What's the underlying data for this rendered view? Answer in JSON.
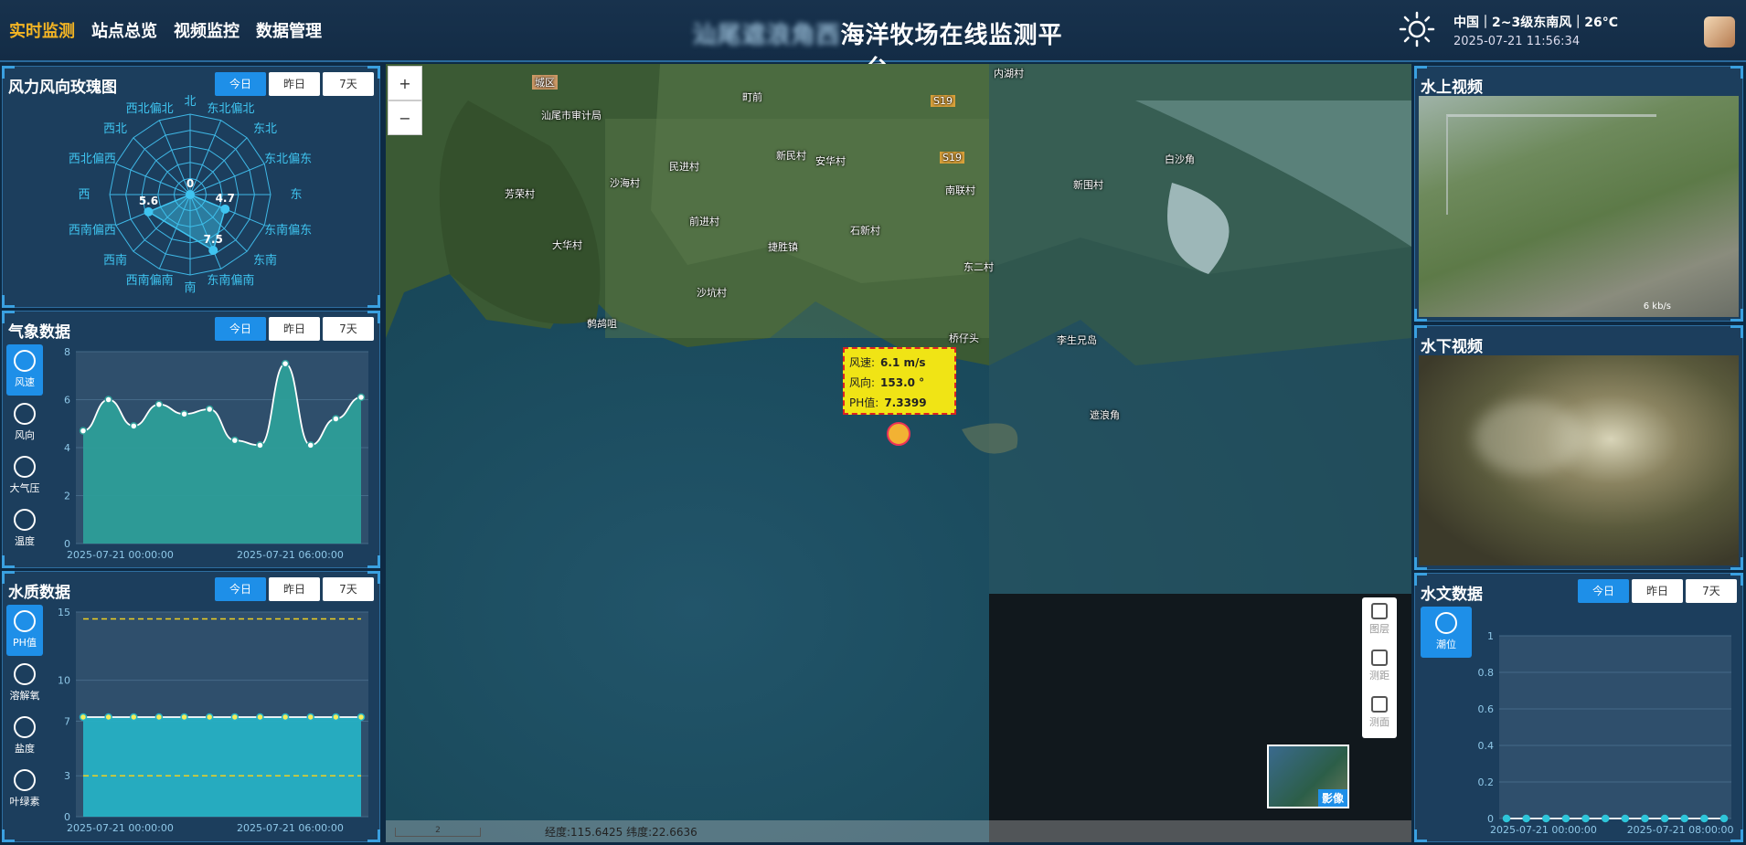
{
  "nav": [
    "实时监测",
    "站点总览",
    "视频监控",
    "数据管理"
  ],
  "title_blur": "汕尾遮浪角西",
  "title": "海洋牧场在线监测平台",
  "weather": {
    "line1": "中国｜2~3级东南风｜26°C",
    "datetime": "2025-07-21 11:56:34",
    "icon": "sun-icon"
  },
  "tabs": [
    "今日",
    "昨日",
    "7天"
  ],
  "rose": {
    "title": "风力风向玫瑰图",
    "directions": [
      "北",
      "东北偏北",
      "东北",
      "东北偏东",
      "东",
      "东南偏东",
      "东南",
      "东南偏南",
      "南",
      "西南偏南",
      "西南",
      "西南偏西",
      "西",
      "西北偏西",
      "西北",
      "西北偏北"
    ],
    "values": [
      {
        "dir": "北",
        "value": 0
      },
      {
        "dir": "东南偏东",
        "value": 4.7
      },
      {
        "dir": "东南偏南",
        "value": 7.5
      },
      {
        "dir": "西南偏西",
        "value": 5.6
      }
    ],
    "max": 10
  },
  "weather_panel": {
    "title": "气象数据",
    "buttons": [
      {
        "label": "风速",
        "icon": "fan-icon"
      },
      {
        "label": "风向",
        "icon": "wind-direction-icon"
      },
      {
        "label": "大气压",
        "icon": "pressure-icon"
      },
      {
        "label": "温度",
        "icon": "thermometer-icon"
      }
    ]
  },
  "water_panel": {
    "title": "水质数据",
    "buttons": [
      {
        "label": "PH值",
        "icon": "ph-icon"
      },
      {
        "label": "溶解氧",
        "icon": "oxygen-icon"
      },
      {
        "label": "盐度",
        "icon": "salinity-icon"
      },
      {
        "label": "叶绿素",
        "icon": "chlorophyll-icon"
      }
    ]
  },
  "hydro_panel": {
    "title": "水文数据",
    "buttons": [
      {
        "label": "潮位",
        "icon": "tide-icon"
      }
    ]
  },
  "video_above": {
    "title": "水上视频",
    "speed": "6 kb/s"
  },
  "video_below": {
    "title": "水下视频"
  },
  "map": {
    "zoom_in": "+",
    "zoom_out": "−",
    "labels": [
      "城区",
      "汕尾市审计局",
      "町前",
      "内湖村",
      "芳荣村",
      "沙海村",
      "民进村",
      "新民村",
      "安华村",
      "白沙角",
      "新围村",
      "大华村",
      "前进村",
      "捷胜镇",
      "石新村",
      "南联村",
      "东二村",
      "沙坑村",
      "鹩鸪咀",
      "桥仔头",
      "李生兄岛",
      "遮浪角",
      "S19",
      "S19"
    ],
    "popup": {
      "speed_label": "风速:",
      "speed": "6.1 m/s",
      "dir_label": "风向:",
      "dir": "153.0 °",
      "ph_label": "PH值:",
      "ph": "7.3399"
    },
    "tools": [
      "图层",
      "测距",
      "测面"
    ],
    "basemap": "影像",
    "coords": "经度:115.6425 纬度:22.6636",
    "scale": "2"
  },
  "chart_data": [
    {
      "type": "area",
      "name": "wind-speed",
      "x_ticks": [
        "2025-07-21 00:00:00",
        "2025-07-21 06:00:00"
      ],
      "values": [
        4.7,
        6.0,
        4.9,
        5.8,
        5.4,
        5.6,
        4.3,
        4.1,
        7.5,
        4.1,
        5.2,
        6.1
      ],
      "ylim": [
        0,
        8
      ],
      "yticks": [
        0,
        2,
        4,
        6,
        8
      ],
      "color": "#2d9e99"
    },
    {
      "type": "area",
      "name": "ph",
      "x_ticks": [
        "2025-07-21 00:00:00",
        "2025-07-21 06:00:00"
      ],
      "values": [
        7.3,
        7.3,
        7.3,
        7.3,
        7.3,
        7.3,
        7.3,
        7.3,
        7.3,
        7.3,
        7.3,
        7.3
      ],
      "ylim": [
        0,
        15
      ],
      "yticks": [
        0,
        3,
        7,
        10,
        15
      ],
      "upper_limit": 14.5,
      "lower_limit": 3,
      "color": "#26b0c4"
    },
    {
      "type": "line",
      "name": "tide",
      "x_ticks": [
        "2025-07-21 00:00:00",
        "2025-07-21 08:00:00"
      ],
      "values": [
        0,
        0,
        0,
        0,
        0,
        0,
        0,
        0,
        0,
        0,
        0,
        0
      ],
      "ylim": [
        0,
        1
      ],
      "yticks": [
        0,
        0.2,
        0.4,
        0.6,
        0.8,
        1
      ],
      "color": "#2ec5d9"
    }
  ]
}
